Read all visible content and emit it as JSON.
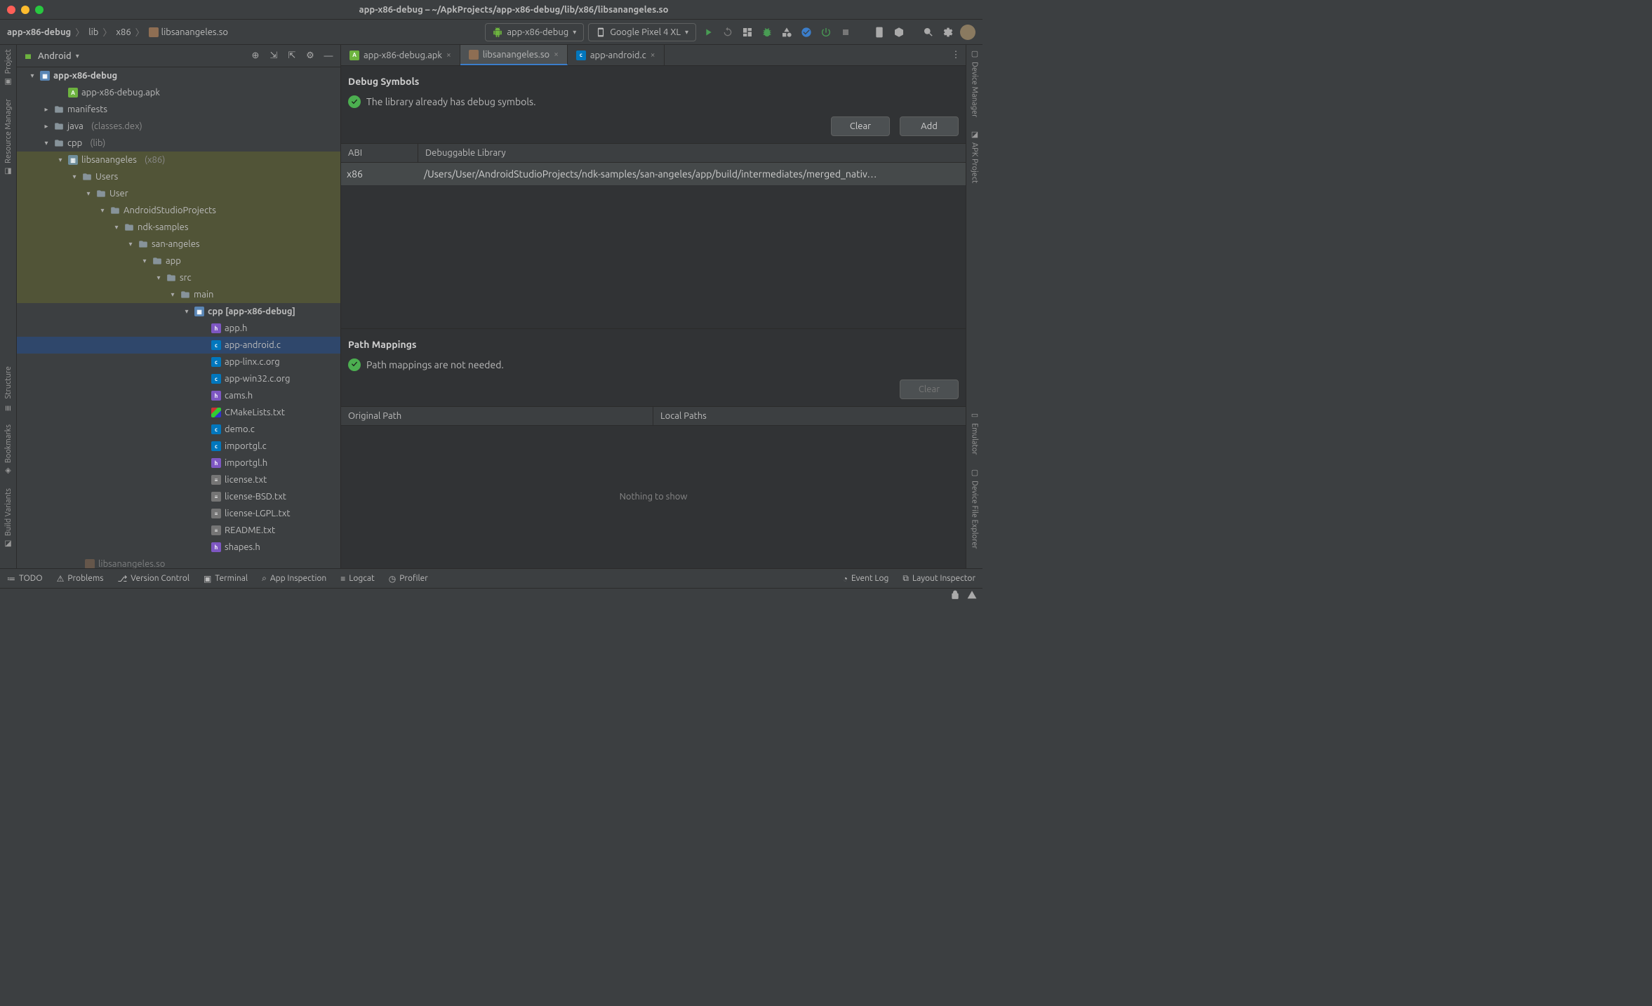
{
  "titlebar": {
    "title": "app-x86-debug – ~/ApkProjects/app-x86-debug/lib/x86/libsanangeles.so"
  },
  "breadcrumb": {
    "items": [
      "app-x86-debug",
      "lib",
      "x86",
      "libsanangeles.so"
    ]
  },
  "runconfig": {
    "label": "app-x86-debug"
  },
  "device": {
    "label": "Google Pixel 4 XL"
  },
  "project": {
    "scope": "Android",
    "tree": {
      "root": "app-x86-debug",
      "apk": "app-x86-debug.apk",
      "manifests": "manifests",
      "java": "java",
      "java_suffix": "(classes.dex)",
      "cpp": "cpp",
      "cpp_suffix": "(lib)",
      "lib": "libsanangeles",
      "lib_suffix": "(x86)",
      "p0": "Users",
      "p1": "User",
      "p2": "AndroidStudioProjects",
      "p3": "ndk-samples",
      "p4": "san-angeles",
      "p5": "app",
      "p6": "src",
      "p7": "main",
      "cppdir": "cpp",
      "cppdir_suffix": "[app-x86-debug]",
      "files": [
        "app.h",
        "app-android.c",
        "app-linx.c.org",
        "app-win32.c.org",
        "cams.h",
        "CMakeLists.txt",
        "demo.c",
        "importgl.c",
        "importgl.h",
        "license.txt",
        "license-BSD.txt",
        "license-LGPL.txt",
        "README.txt",
        "shapes.h"
      ],
      "tail": "libsanangeles.so"
    }
  },
  "tabs": [
    {
      "label": "app-x86-debug.apk"
    },
    {
      "label": "libsanangeles.so"
    },
    {
      "label": "app-android.c"
    }
  ],
  "debug_symbols": {
    "title": "Debug Symbols",
    "status": "The library already has debug symbols.",
    "buttons": {
      "clear": "Clear",
      "add": "Add"
    },
    "columns": {
      "abi": "ABI",
      "lib": "Debuggable Library"
    },
    "row": {
      "abi": "x86",
      "path": "/Users/User/AndroidStudioProjects/ndk-samples/san-angeles/app/build/intermediates/merged_nativ…"
    }
  },
  "path_mappings": {
    "title": "Path Mappings",
    "status": "Path mappings are not needed.",
    "buttons": {
      "clear": "Clear"
    },
    "columns": {
      "original": "Original Path",
      "local": "Local Paths"
    },
    "empty": "Nothing to show"
  },
  "left_rail": [
    "Project",
    "Resource Manager",
    "Structure",
    "Bookmarks",
    "Build Variants"
  ],
  "right_rail": [
    "Device Manager",
    "APK Project",
    "Emulator",
    "Device File Explorer"
  ],
  "bottom": {
    "items": [
      "TODO",
      "Problems",
      "Version Control",
      "Terminal",
      "App Inspection",
      "Logcat",
      "Profiler"
    ],
    "right": [
      "Event Log",
      "Layout Inspector"
    ]
  }
}
